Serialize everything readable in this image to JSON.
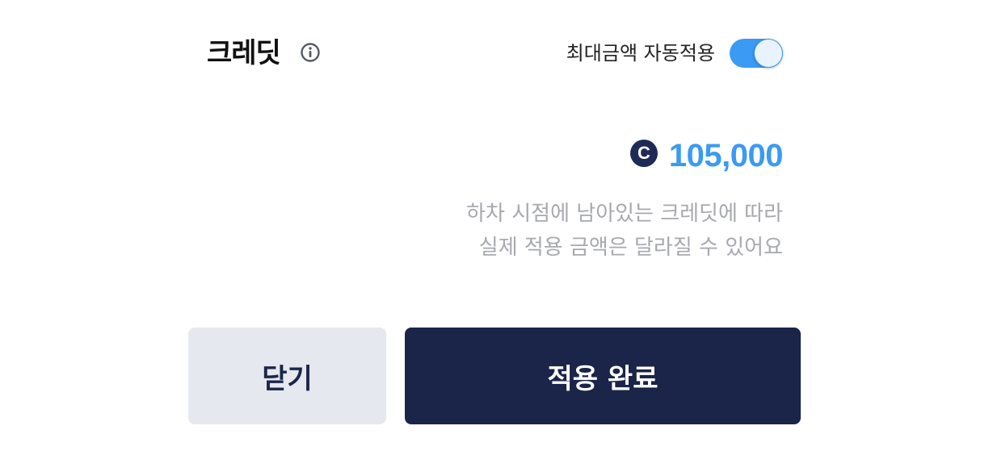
{
  "header": {
    "title": "크레딧",
    "info_icon": "info-circle-icon"
  },
  "auto_apply": {
    "label": "최대금액 자동적용",
    "enabled": true,
    "toggle_color": "#3b9af3"
  },
  "credit": {
    "icon_letter": "C",
    "amount": "105,000",
    "amount_color": "#3b9af3",
    "icon_color": "#1f2a57"
  },
  "notice": {
    "line1": "하차 시점에 남아있는 크레딧에 따라",
    "line2": "실제 적용 금액은 달라질 수 있어요"
  },
  "buttons": {
    "close_label": "닫기",
    "apply_label": "적용 완료",
    "apply_color": "#1b2449",
    "close_color": "#e6e8ef"
  }
}
